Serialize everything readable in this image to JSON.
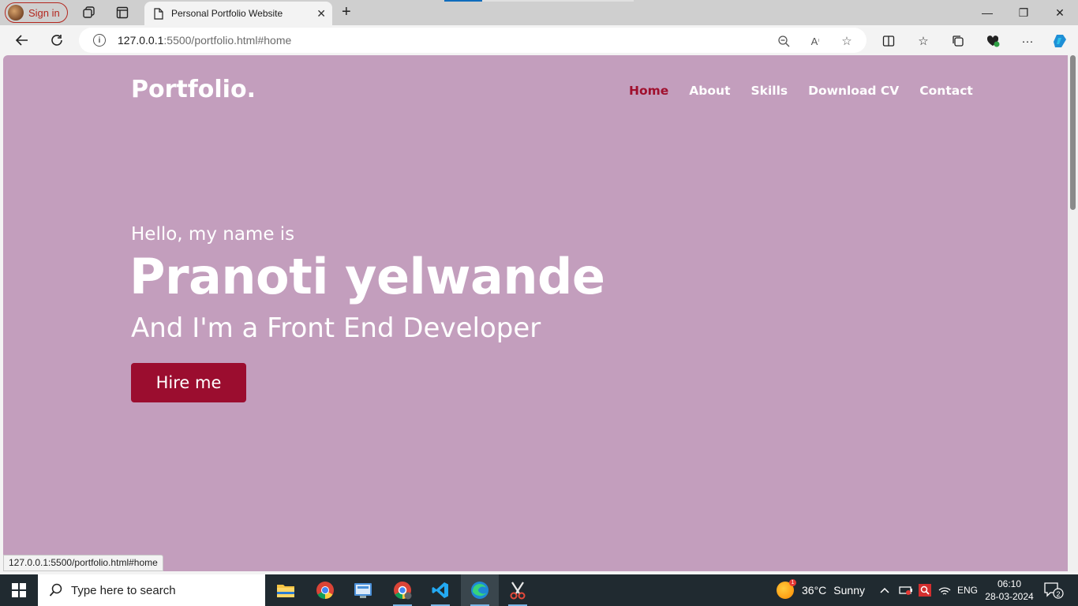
{
  "browser": {
    "signin_label": "Sign in",
    "tab_title": "Personal Portfolio Website",
    "url_host": "127.0.0.1",
    "url_rest": ":5500/portfolio.html#home",
    "status_url": "127.0.0.1:5500/portfolio.html#home"
  },
  "page": {
    "logo": "Portfolio.",
    "nav": [
      "Home",
      "About",
      "Skills",
      "Download CV",
      "Contact"
    ],
    "active_nav": "Home",
    "greeting": "Hello, my name is",
    "name": "Pranoti yelwande",
    "role": "And I'm a Front End Developer",
    "cta": "Hire me",
    "colors": {
      "background": "#c39ebd",
      "accent": "#9b0d2f",
      "text": "#ffffff"
    }
  },
  "taskbar": {
    "search_placeholder": "Type here to search",
    "weather_temp": "36°C",
    "weather_desc": "Sunny",
    "weather_badge": "1",
    "lang": "ENG",
    "time": "06:10",
    "date": "28-03-2024",
    "notifications": "2"
  }
}
